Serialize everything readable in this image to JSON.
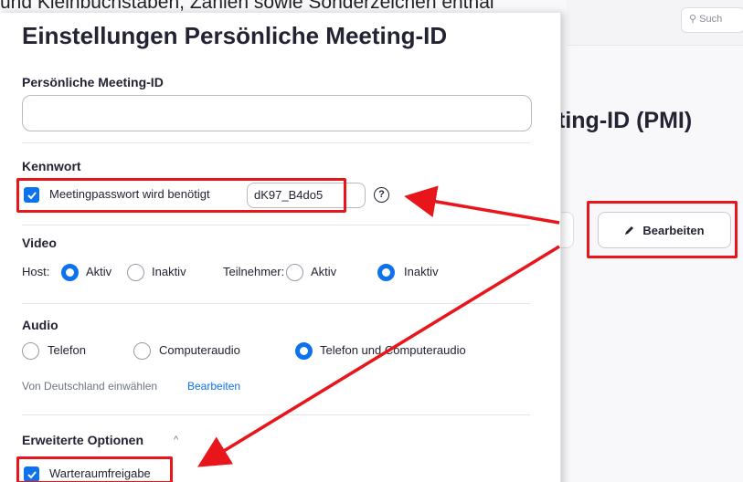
{
  "caption": "und Kleinbuchstaben, Zahlen sowie Sonderzeichen enthal",
  "background": {
    "search_placeholder": "Such",
    "heading": "ting-ID (PMI)",
    "edit_label": "Bearbeiten"
  },
  "modal": {
    "title": "Einstellungen Persönliche Meeting-ID",
    "pmi_section": {
      "label": "Persönliche Meeting-ID",
      "value": ""
    },
    "password_section": {
      "label": "Kennwort",
      "checkbox_label": "Meetingpasswort wird benötigt",
      "checked": true,
      "password": "dK97_B4do5",
      "help_symbol": "?"
    },
    "video_section": {
      "label": "Video",
      "host_label": "Host:",
      "participant_label": "Teilnehmer:",
      "option_on": "Aktiv",
      "option_off": "Inaktiv",
      "host_selected": "Aktiv",
      "participant_selected": "Inaktiv"
    },
    "audio_section": {
      "label": "Audio",
      "options": [
        "Telefon",
        "Computeraudio",
        "Telefon und Computeraudio"
      ],
      "selected": "Telefon und Computeraudio",
      "dial_in_text": "Von Deutschland einwählen",
      "dial_in_edit": "Bearbeiten"
    },
    "advanced_section": {
      "label": "Erweiterte Optionen",
      "caret": "^",
      "waiting_room_label": "Warteraumfreigabe",
      "waiting_room_checked": true
    }
  },
  "annotation_color": "#e8151b",
  "accent_color": "#0e72ed"
}
